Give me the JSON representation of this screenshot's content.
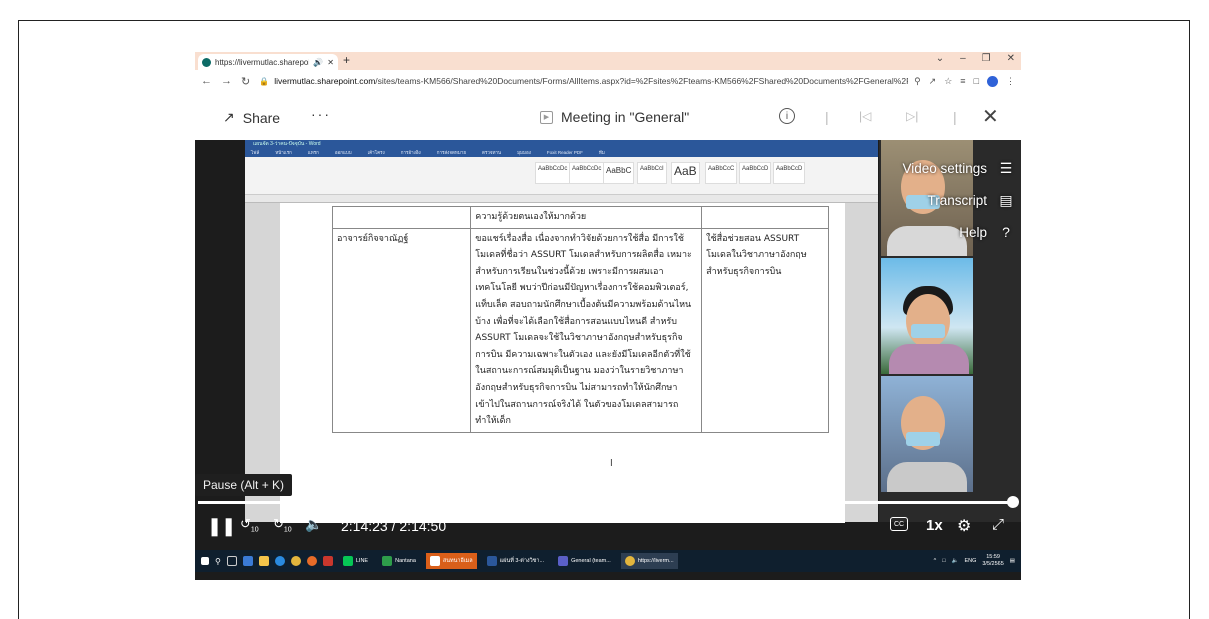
{
  "browser": {
    "tab_title": "https://livermutlac.sharepoi",
    "url_host": "livermutlac.sharepoint.com",
    "url_path": "/sites/teams-KM566/Shared%20Documents/Forms/AllItems.aspx?id=%2Fsites%2Fteams-KM566%2FShared%20Documents%2FGeneral%2FRec..."
  },
  "player": {
    "share_label": "Share",
    "more_label": "···",
    "title": "Meeting in \"General\""
  },
  "word": {
    "title_bar": "แผนจัด 3-ว่าคน-ปัจจุบัน - Word",
    "tabs": [
      "ไฟล์",
      "หน้าแรก",
      "แทรก",
      "ออกแบบ",
      "เค้าโครง",
      "การอ้างอิง",
      "การส่งจดหมาย",
      "ตรวจทาน",
      "มุมมอง",
      "Foxit Reader PDF",
      "ทีม"
    ],
    "styles": [
      "AaBbCcDc",
      "AaBbCcDc",
      "AaBbC",
      "AaBbCcI",
      "AaB",
      "AaBbCcC",
      "AaBbCcD",
      "AaBbCcD"
    ],
    "table": {
      "row0": "ความรู้ด้วยตนเองให้มากด้วย",
      "name": "อาจารย์กิจจาณัฏฐ์",
      "comment": "ขอแชร์เรื่องสื่อ เนื่องจากทำวิจัยด้วยการใช้สื่อ มีการใช้โมเดลที่ชื่อว่า ASSURT โมเดลสำหรับการผลิตสื่อ เหมาะสำหรับการเรียนในช่วงนี้ด้วย เพราะมีการผสมเอาเทคโนโลยี พบว่าปีก่อนมีปัญหาเรื่องการใช้คอมพิวเตอร์, แท็บเล็ต สอบถามนักศึกษาเบื้องต้นมีความพร้อมด้านไหนบ้าง เพื่อที่จะได้เลือกใช้สื่อการสอนแบบไหนดี สำหรับ ASSURT โมเดลจะใช้ในวิชาภาษาอังกฤษสำหรับธุรกิจการบิน มีความเฉพาะในตัวเอง และยังมีโมเดลอีกตัวที่ใช้ในสถานะการณ์สมมุติเป็นฐาน มองว่าในรายวิชาภาษาอังกฤษสำหรับธุรกิจการบิน ไม่สามารถทำให้นักศึกษาเข้าไปในสถานการณ์จริงได้ ในตัวของโมเดลสามารถทำให้เด็ก",
      "note": "ใช้สื่อช่วยสอน ASSURT โมเดลในวิชาภาษาอังกฤษสำหรับธุรกิจการบิน"
    }
  },
  "settings_menu": {
    "video_settings": "Video settings",
    "transcript": "Transcript",
    "help": "Help"
  },
  "tooltip": "Pause (Alt + K)",
  "playback": {
    "current_time": "2:14:23",
    "separator": "/",
    "duration": "2:14:50",
    "rate": "1x",
    "progress": 0.9967,
    "skip_back": "10",
    "skip_fwd": "10"
  },
  "taskbar": {
    "apps": [
      "LINE",
      "Nantana",
      "สนทนาอีเมล",
      "แผ่นที่ 3-ต่างวิชา...",
      "General (team...",
      "https://liverm..."
    ],
    "lang": "ENG",
    "time": "15:59",
    "date": "3/5/2565"
  },
  "colors": {
    "tabbar": "#f9dfd0",
    "word_blue": "#2b579a",
    "video_bg": "#1c1c1c"
  }
}
